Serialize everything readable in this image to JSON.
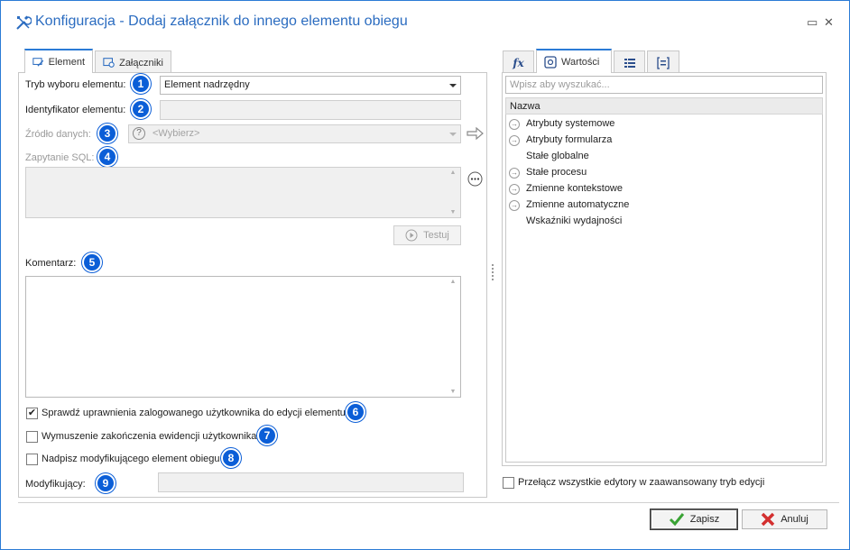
{
  "window": {
    "title": "Konfiguracja - Dodaj załącznik do innego elementu obiegu",
    "maximize_glyph": "▭",
    "close_glyph": "✕"
  },
  "left_tabs": [
    {
      "label": "Element",
      "active": true
    },
    {
      "label": "Załączniki",
      "active": false
    }
  ],
  "form": {
    "tryb_label": "Tryb wyboru elementu:",
    "tryb_value": "Element nadrzędny",
    "identyfikator_label": "Identyfikator elementu:",
    "identyfikator_value": "",
    "zrodlo_label": "Źródło danych:",
    "zrodlo_value": "<Wybierz>",
    "zapytanie_label": "Zapytanie SQL:",
    "testuj_label": "Testuj",
    "komentarz_label": "Komentarz:",
    "check_uprawnienia_label": "Sprawdź uprawnienia zalogowanego użytkownika do edycji elementu",
    "check_uprawnienia_checked": true,
    "check_wymuszenie_label": "Wymuszenie zakończenia ewidencji użytkownika",
    "check_wymuszenie_checked": false,
    "check_nadpisz_label": "Nadpisz modyfikującego element obiegu",
    "check_nadpisz_checked": false,
    "modyfikujacy_label": "Modyfikujący:"
  },
  "badges": [
    "1",
    "2",
    "3",
    "4",
    "5",
    "6",
    "7",
    "8",
    "9"
  ],
  "right_tabs": [
    {
      "label": "fx",
      "icon": "function-icon"
    },
    {
      "label": "Wartości",
      "icon": "values-icon",
      "active": true
    },
    {
      "label": "",
      "icon": "list-icon"
    },
    {
      "label": "",
      "icon": "bracket-list-icon"
    }
  ],
  "right_panel": {
    "search_placeholder": "Wpisz aby wyszukać...",
    "column_header": "Nazwa",
    "items": [
      {
        "label": "Atrybuty systemowe",
        "expandable": true
      },
      {
        "label": "Atrybuty formularza",
        "expandable": true
      },
      {
        "label": "Stałe globalne",
        "expandable": false
      },
      {
        "label": "Stałe procesu",
        "expandable": true
      },
      {
        "label": "Zmienne kontekstowe",
        "expandable": true
      },
      {
        "label": "Zmienne automatyczne",
        "expandable": true
      },
      {
        "label": "Wskaźniki wydajności",
        "expandable": false
      }
    ],
    "advanced_mode_label": "Przełącz wszystkie edytory w zaawansowany tryb edycji"
  },
  "footer": {
    "save_label": "Zapisz",
    "cancel_label": "Anuluj"
  },
  "colors": {
    "accent": "#2b7bd6",
    "badge": "#0b5ed7",
    "save_icon": "#3aa335",
    "cancel_icon": "#d32f2f"
  }
}
